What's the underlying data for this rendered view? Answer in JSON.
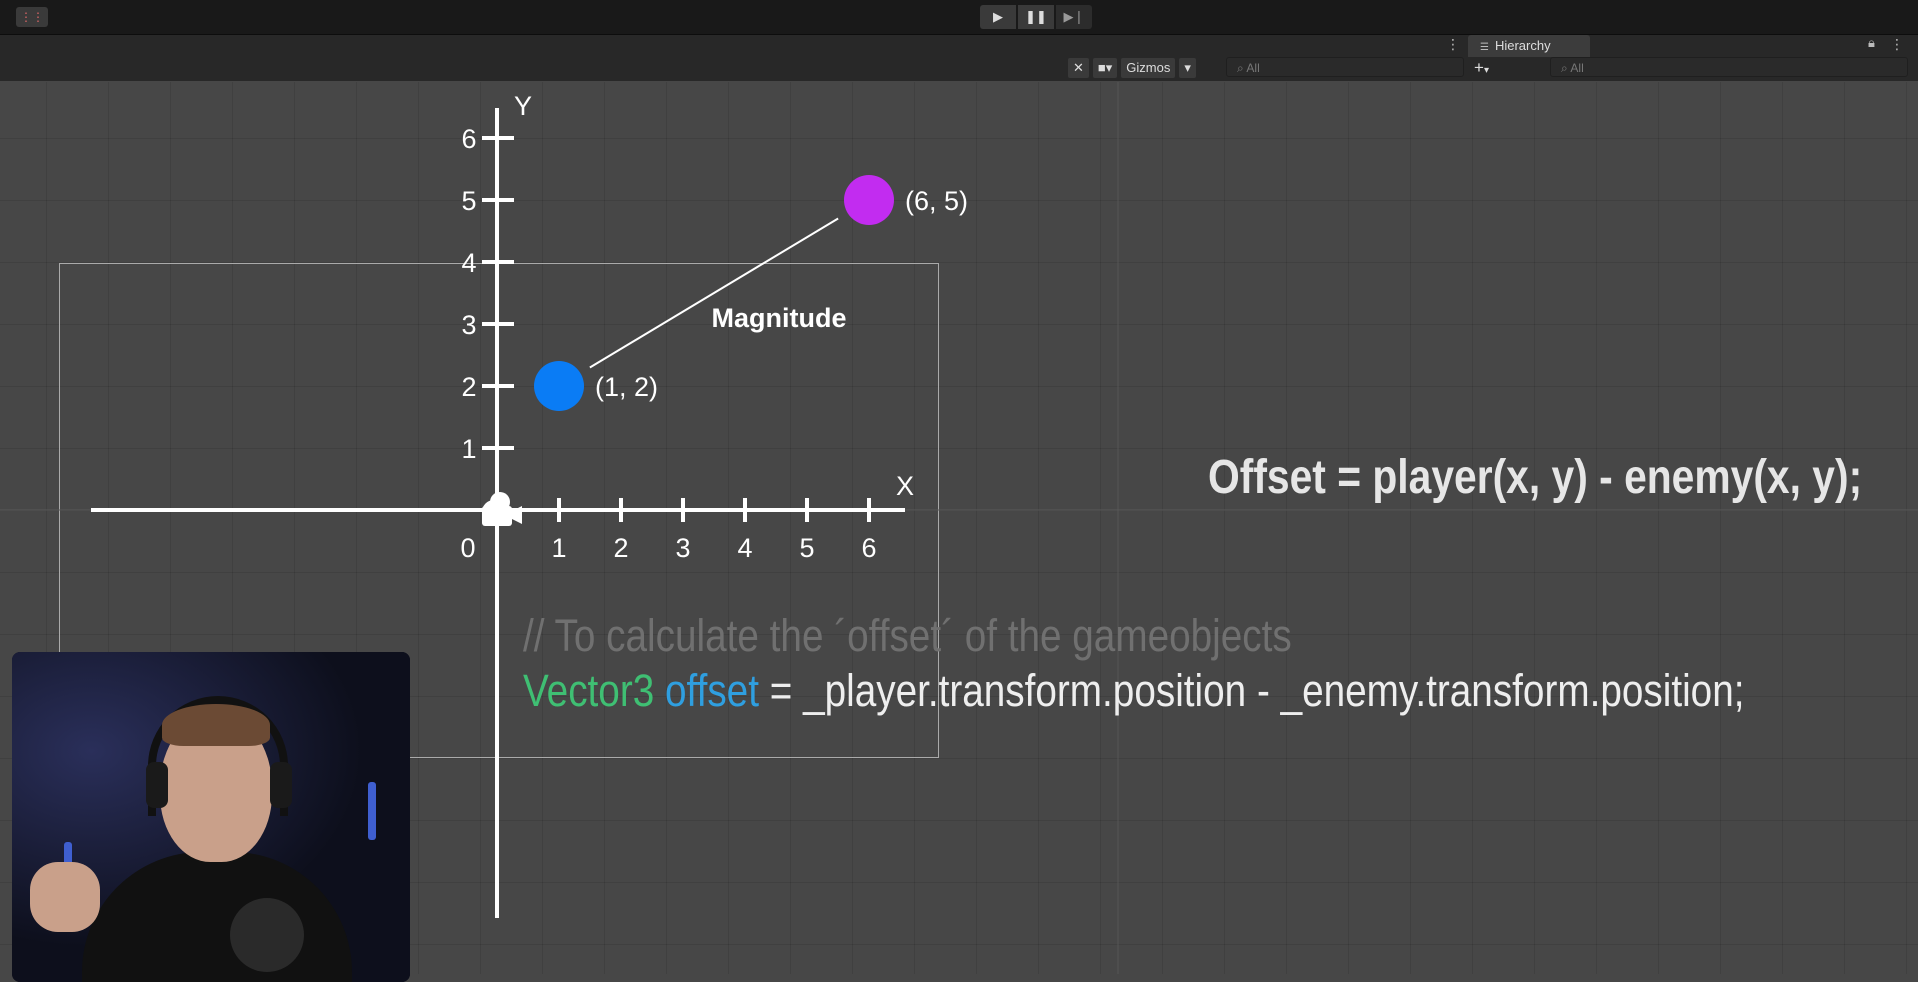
{
  "toolbar": {
    "play_icon": "▶",
    "pause_icon": "❚❚",
    "step_icon": "▶❘"
  },
  "hierarchy": {
    "title": "Hierarchy",
    "search_placeholder": "All",
    "add_label": "+"
  },
  "scene": {
    "gizmos_label": "Gizmos",
    "search_placeholder": "All"
  },
  "graph": {
    "x_axis_label": "X",
    "y_axis_label": "Y",
    "origin_label": "0",
    "x_ticks": [
      "1",
      "2",
      "3",
      "4",
      "5",
      "6"
    ],
    "y_ticks": [
      "1",
      "2",
      "3",
      "4",
      "5",
      "6"
    ],
    "points": [
      {
        "label": "(1, 2)",
        "x": 1,
        "y": 2,
        "color": "#0a7cf5"
      },
      {
        "label": "(6, 5)",
        "x": 6,
        "y": 5,
        "color": "#c22cf0"
      }
    ],
    "line_label": "Magnitude"
  },
  "formula": "Offset = player(x, y) - enemy(x, y);",
  "code": {
    "comment": "// To calculate the ´offset´ of the gameobjects",
    "type_kw": "Vector3",
    "var_name": "offset",
    "expression": " = _player.transform.position - _enemy.transform.position;"
  },
  "colors": {
    "background": "#474747",
    "keyword": "#3fbf73",
    "variable": "#2f9fe0"
  }
}
